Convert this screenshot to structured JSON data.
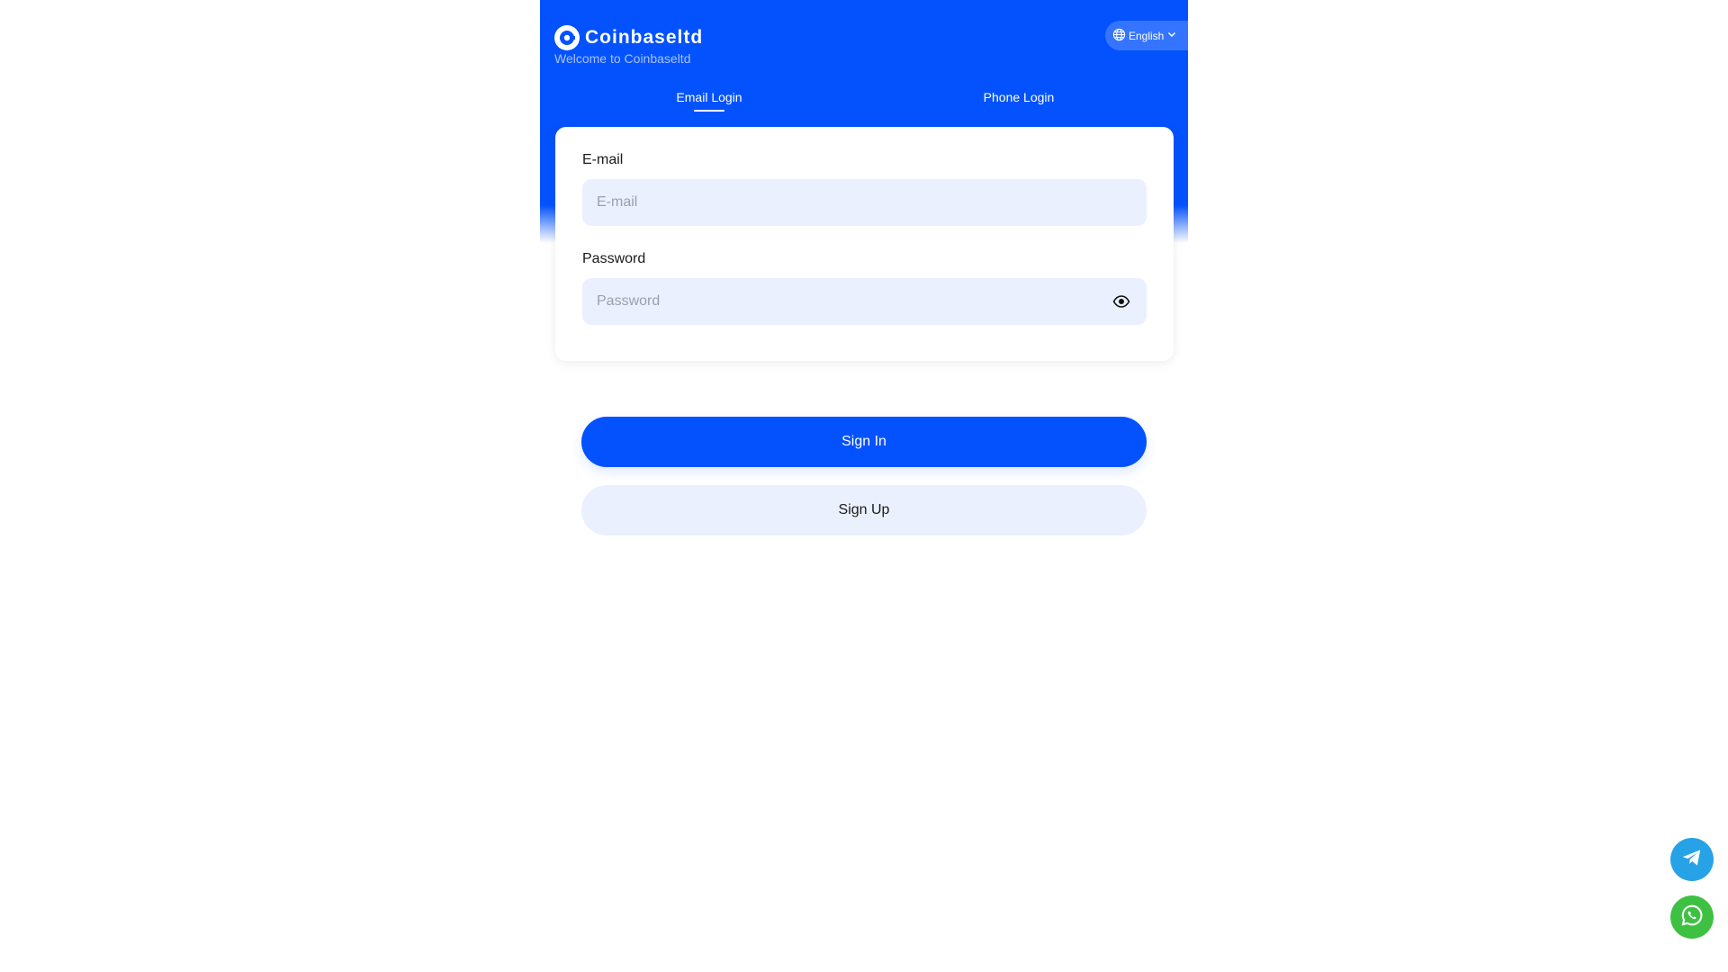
{
  "header": {
    "brand_name": "Coinbaseltd",
    "welcome_text": "Welcome to Coinbaseltd",
    "language": {
      "label": "English",
      "icon": "globe-icon"
    }
  },
  "tabs": [
    {
      "label": "Email Login",
      "active": true
    },
    {
      "label": "Phone Login",
      "active": false
    }
  ],
  "form": {
    "email": {
      "label": "E-mail",
      "placeholder": "E-mail",
      "value": ""
    },
    "password": {
      "label": "Password",
      "placeholder": "Password",
      "value": "",
      "toggle_icon": "eye-icon"
    }
  },
  "actions": {
    "sign_in": "Sign In",
    "sign_up": "Sign Up"
  },
  "floating": [
    {
      "icon": "telegram-icon",
      "color": "#27a2e6"
    },
    {
      "icon": "whatsapp-icon",
      "color": "#3ec143"
    }
  ],
  "colors": {
    "primary": "#0352fe",
    "field_bg": "#ebf0fe",
    "welcome_text": "#a9c2ff"
  }
}
